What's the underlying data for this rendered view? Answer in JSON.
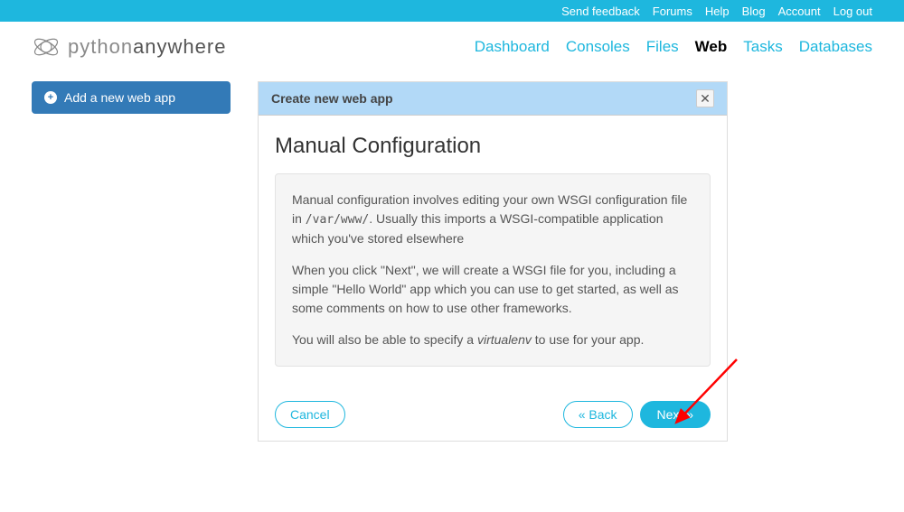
{
  "topbar": {
    "links": [
      "Send feedback",
      "Forums",
      "Help",
      "Blog",
      "Account",
      "Log out"
    ]
  },
  "logo": {
    "part1": "python",
    "part2": "anywhere"
  },
  "nav": {
    "items": [
      {
        "label": "Dashboard",
        "active": false
      },
      {
        "label": "Consoles",
        "active": false
      },
      {
        "label": "Files",
        "active": false
      },
      {
        "label": "Web",
        "active": true
      },
      {
        "label": "Tasks",
        "active": false
      },
      {
        "label": "Databases",
        "active": false
      }
    ]
  },
  "sidebar": {
    "add_button": "Add a new web app"
  },
  "wizard": {
    "header_title": "Create new web app",
    "title": "Manual Configuration",
    "para1a": "Manual configuration involves editing your own WSGI configuration file in ",
    "para1code": "/var/www/",
    "para1b": ". Usually this imports a WSGI-compatible application which you've stored elsewhere",
    "para2": "When you click \"Next\", we will create a WSGI file for you, including a simple \"Hello World\" app which you can use to get started, as well as some comments on how to use other frameworks.",
    "para3a": "You will also be able to specify a ",
    "para3em": "virtualenv",
    "para3b": " to use for your app.",
    "cancel": "Cancel",
    "back": "« Back",
    "next": "Next »"
  }
}
